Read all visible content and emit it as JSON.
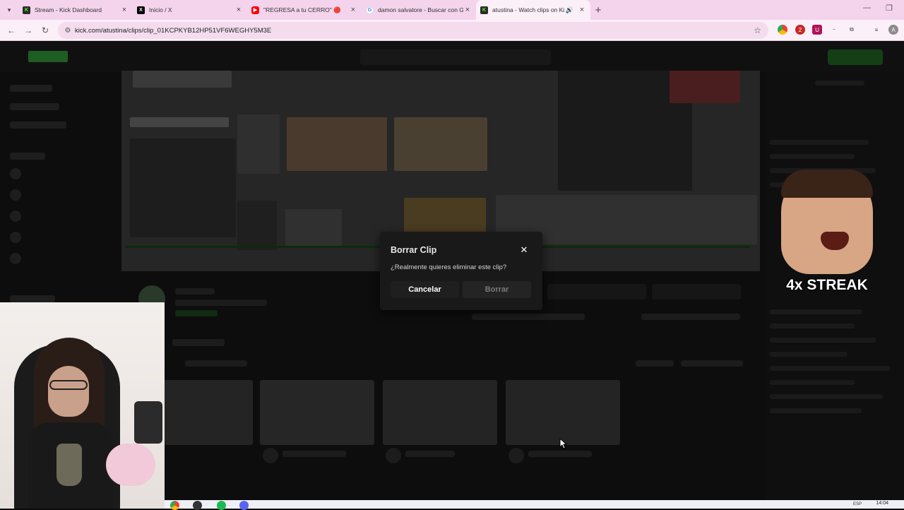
{
  "browser": {
    "tabs": [
      {
        "title": "Stream - Kick Dashboard",
        "favicon": "kick-icon",
        "color": "#53fc18"
      },
      {
        "title": "Inicio / X",
        "favicon": "x-icon",
        "color": "#000000"
      },
      {
        "title": "\"REGRESA a tu CERRO\" 🔴",
        "favicon": "youtube-icon",
        "color": "#ff0000"
      },
      {
        "title": "damon salvatore - Buscar con G",
        "favicon": "google-icon",
        "color": "#4285f4"
      },
      {
        "title": "atustina - Watch clips on Ki",
        "favicon": "kick-icon",
        "color": "#53fc18"
      }
    ],
    "active_tab": 4,
    "url": "kick.com/atustina/clips/clip_01KCPKYB12HP51VF6WEGHY5M3E"
  },
  "overlay": {
    "streak_label": "4x STREAK"
  },
  "modal": {
    "title": "Borrar Clip",
    "message": "¿Realmente quieres eliminar este clip?",
    "cancel_label": "Cancelar",
    "delete_label": "Borrar",
    "close_icon": "close-icon"
  },
  "taskbar": {
    "time": "14:04",
    "lang": "ESP"
  },
  "colors": {
    "kick_green": "#53fc18",
    "modal_bg": "#191919",
    "tab_bar": "#f4d3ec"
  }
}
